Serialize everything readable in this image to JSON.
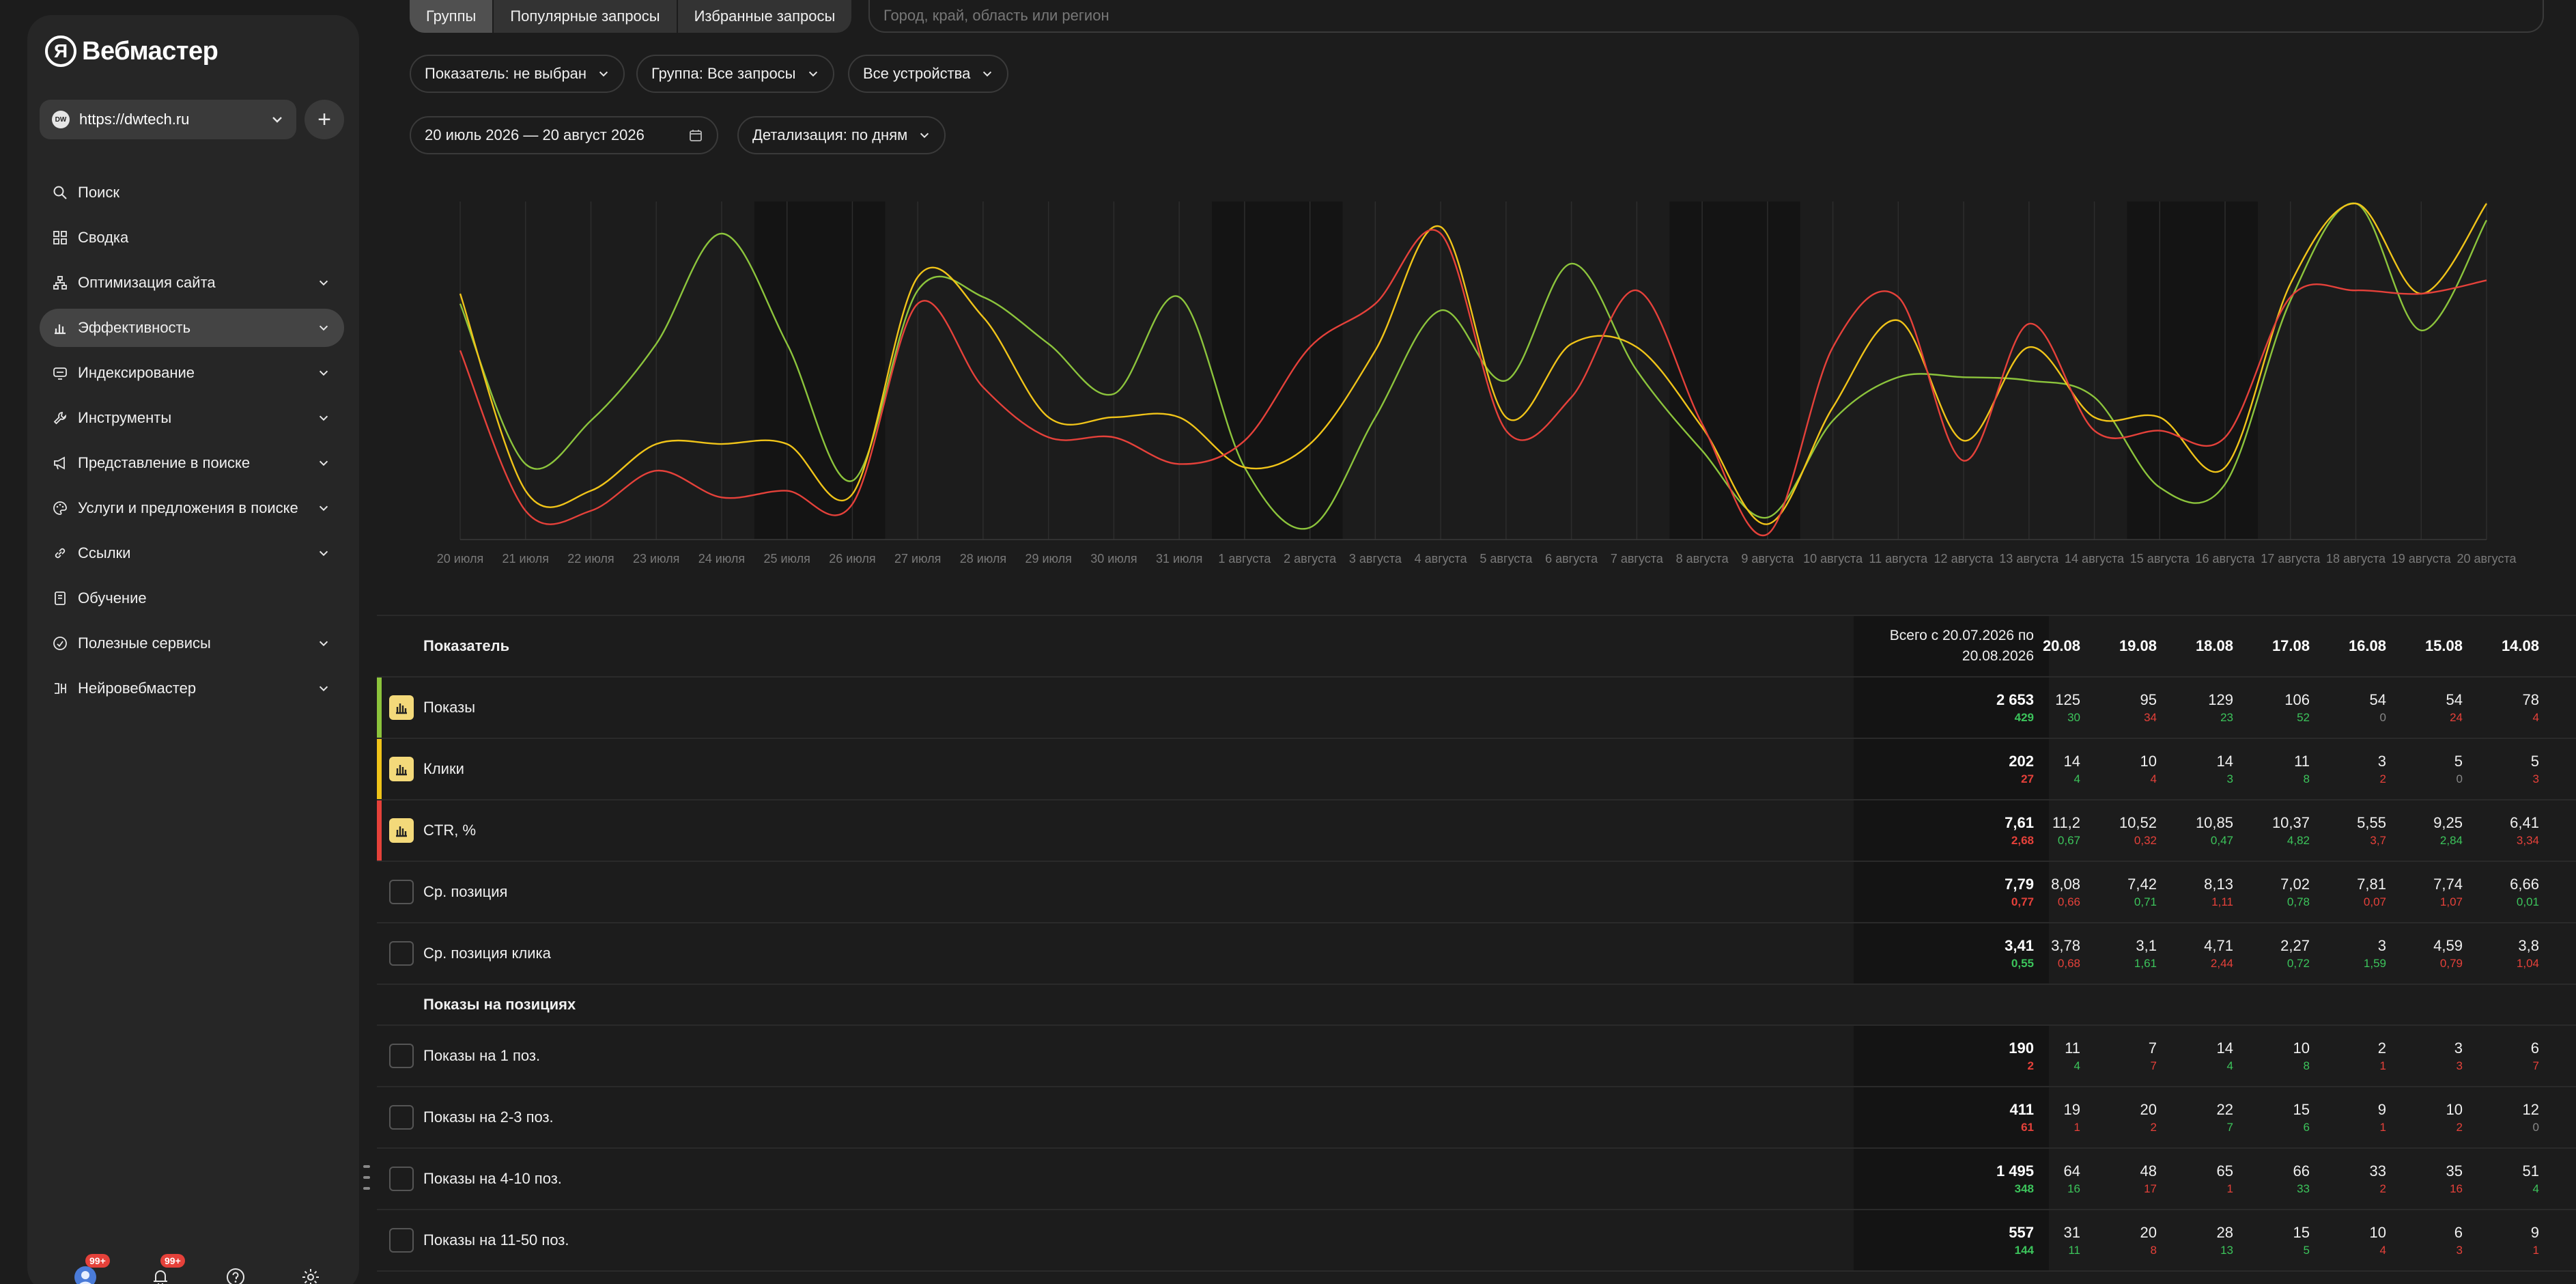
{
  "app": {
    "brand_letter": "Я",
    "brand": "Вебмастер"
  },
  "site": {
    "favicon": "DW",
    "url": "https://dwtech.ru",
    "add_label": "+"
  },
  "nav": [
    {
      "label": "Поиск",
      "icon": "search-icon",
      "expandable": false
    },
    {
      "label": "Сводка",
      "icon": "grid-icon",
      "expandable": false
    },
    {
      "label": "Оптимизация сайта",
      "icon": "hierarchy-icon",
      "expandable": true
    },
    {
      "label": "Эффективность",
      "icon": "bar-chart-icon",
      "expandable": true,
      "active": true
    },
    {
      "label": "Индексирование",
      "icon": "index-icon",
      "expandable": true
    },
    {
      "label": "Инструменты",
      "icon": "wrench-icon",
      "expandable": true
    },
    {
      "label": "Представление в поиске",
      "icon": "megaphone-icon",
      "expandable": true
    },
    {
      "label": "Услуги и предложения в поиске",
      "icon": "palette-icon",
      "expandable": true
    },
    {
      "label": "Ссылки",
      "icon": "link-icon",
      "expandable": true
    },
    {
      "label": "Обучение",
      "icon": "book-icon",
      "expandable": false
    },
    {
      "label": "Полезные сервисы",
      "icon": "services-icon",
      "expandable": true
    },
    {
      "label": "Нейровебмастер",
      "icon": "neuro-icon",
      "expandable": true
    }
  ],
  "bottom": {
    "avatar_badge": "99+",
    "bell_badge": "99+"
  },
  "tabs": [
    "Группы",
    "Популярные запросы",
    "Избранные запросы"
  ],
  "region_placeholder": "Город, край, область или регион",
  "filters": {
    "metric": "Показатель: не выбран",
    "group": "Группа: Все запросы",
    "devices": "Все устройства",
    "period": "20 июль 2026 — 20 август 2026",
    "detail": "Детализация: по дням"
  },
  "chart_data": {
    "type": "line",
    "categories": [
      "20 июля",
      "21 июля",
      "22 июля",
      "23 июля",
      "24 июля",
      "25 июля",
      "26 июля",
      "27 июля",
      "28 июля",
      "29 июля",
      "30 июля",
      "31 июля",
      "1 августа",
      "2 августа",
      "3 августа",
      "4 августа",
      "5 августа",
      "6 августа",
      "7 августа",
      "8 августа",
      "9 августа",
      "10 августа",
      "11 августа",
      "12 августа",
      "13 августа",
      "14 августа",
      "15 августа",
      "16 августа",
      "17 августа",
      "18 августа",
      "19 августа",
      "20 августа"
    ],
    "weekend_ranges": [
      [
        4.5,
        6.5
      ],
      [
        11.5,
        13.5
      ],
      [
        18.5,
        20.5
      ],
      [
        25.5,
        27.5
      ]
    ],
    "series": [
      {
        "color": "#8cc43c",
        "values": [
          70,
          22,
          35,
          58,
          91,
          58,
          17,
          74,
          72,
          58,
          43,
          72,
          21,
          3,
          36,
          68,
          47,
          82,
          50,
          26,
          6,
          35,
          48,
          48,
          47,
          42,
          15,
          16,
          71,
          100,
          62,
          95
        ]
      },
      {
        "color": "#f0c419",
        "values": [
          73,
          14,
          14,
          28,
          28,
          28,
          13,
          78,
          66,
          36,
          36,
          36,
          21,
          28,
          56,
          93,
          36,
          58,
          57,
          33,
          4,
          39,
          65,
          29,
          57,
          36,
          36,
          21,
          76,
          100,
          73,
          100
        ]
      },
      {
        "color": "#e5413a",
        "values": [
          56,
          8,
          8,
          20,
          12,
          14,
          10,
          70,
          45,
          30,
          30,
          22,
          29,
          57,
          70,
          91,
          32,
          42,
          74,
          34,
          1,
          57,
          72,
          23,
          64,
          32,
          32,
          30,
          72,
          74,
          73,
          77
        ]
      }
    ]
  },
  "table": {
    "header": {
      "label": "Показатель",
      "total_line1": "Всего с 20.07.2026 по",
      "total_line2": "20.08.2026",
      "dates": [
        "20.08",
        "19.08",
        "18.08",
        "17.08",
        "16.08",
        "15.08",
        "14.08"
      ]
    },
    "rows": [
      {
        "label": "Показы",
        "color": "#8cc43c",
        "selected": true,
        "total": "2 653",
        "total_delta": "429",
        "total_dir": "up",
        "values": [
          "125",
          "95",
          "129",
          "106",
          "54",
          "54",
          "78"
        ],
        "deltas": [
          "30",
          "34",
          "23",
          "52",
          "0",
          "24",
          "4"
        ],
        "dirs": [
          "up",
          "dn",
          "up",
          "up",
          "zero",
          "dn",
          "dn"
        ]
      },
      {
        "label": "Клики",
        "color": "#f0c419",
        "selected": true,
        "total": "202",
        "total_delta": "27",
        "total_dir": "dn",
        "values": [
          "14",
          "10",
          "14",
          "11",
          "3",
          "5",
          "5"
        ],
        "deltas": [
          "4",
          "4",
          "3",
          "8",
          "2",
          "0",
          "3"
        ],
        "dirs": [
          "up",
          "dn",
          "up",
          "up",
          "dn",
          "zero",
          "dn"
        ]
      },
      {
        "label": "CTR, %",
        "color": "#e5413a",
        "selected": true,
        "total": "7,61",
        "total_delta": "2,68",
        "total_dir": "dn",
        "values": [
          "11,2",
          "10,52",
          "10,85",
          "10,37",
          "5,55",
          "9,25",
          "6,41"
        ],
        "deltas": [
          "0,67",
          "0,32",
          "0,47",
          "4,82",
          "3,7",
          "2,84",
          "3,34"
        ],
        "dirs": [
          "up",
          "dn",
          "up",
          "up",
          "dn",
          "up",
          "dn"
        ]
      },
      {
        "label": "Ср. позиция",
        "selected": false,
        "total": "7,79",
        "total_delta": "0,77",
        "total_dir": "dn",
        "values": [
          "8,08",
          "7,42",
          "8,13",
          "7,02",
          "7,81",
          "7,74",
          "6,66"
        ],
        "deltas": [
          "0,66",
          "0,71",
          "1,11",
          "0,78",
          "0,07",
          "1,07",
          "0,01"
        ],
        "dirs": [
          "dn",
          "up",
          "dn",
          "up",
          "dn",
          "dn",
          "up"
        ]
      },
      {
        "label": "Ср. позиция клика",
        "selected": false,
        "total": "3,41",
        "total_delta": "0,55",
        "total_dir": "up",
        "values": [
          "3,78",
          "3,1",
          "4,71",
          "2,27",
          "3",
          "4,59",
          "3,8"
        ],
        "deltas": [
          "0,68",
          "1,61",
          "2,44",
          "0,72",
          "1,59",
          "0,79",
          "1,04"
        ],
        "dirs": [
          "dn",
          "up",
          "dn",
          "up",
          "up",
          "dn",
          "dn"
        ]
      }
    ],
    "section_label": "Показы на позициях",
    "position_rows": [
      {
        "label": "Показы на 1 поз.",
        "total": "190",
        "total_delta": "2",
        "total_dir": "dn",
        "values": [
          "11",
          "7",
          "14",
          "10",
          "2",
          "3",
          "6"
        ],
        "deltas": [
          "4",
          "7",
          "4",
          "8",
          "1",
          "3",
          "7"
        ],
        "dirs": [
          "up",
          "dn",
          "up",
          "up",
          "dn",
          "dn",
          "dn"
        ]
      },
      {
        "label": "Показы на 2-3 поз.",
        "total": "411",
        "total_delta": "61",
        "total_dir": "dn",
        "values": [
          "19",
          "20",
          "22",
          "15",
          "9",
          "10",
          "12"
        ],
        "deltas": [
          "1",
          "2",
          "7",
          "6",
          "1",
          "2",
          "0"
        ],
        "dirs": [
          "dn",
          "dn",
          "up",
          "up",
          "dn",
          "dn",
          "zero"
        ]
      },
      {
        "label": "Показы на 4-10 поз.",
        "total": "1 495",
        "total_delta": "348",
        "total_dir": "up",
        "values": [
          "64",
          "48",
          "65",
          "66",
          "33",
          "35",
          "51"
        ],
        "deltas": [
          "16",
          "17",
          "1",
          "33",
          "2",
          "16",
          "4"
        ],
        "dirs": [
          "up",
          "dn",
          "dn",
          "up",
          "dn",
          "dn",
          "up"
        ]
      },
      {
        "label": "Показы на 11-50 поз.",
        "total": "557",
        "total_delta": "144",
        "total_dir": "up",
        "values": [
          "31",
          "20",
          "28",
          "15",
          "10",
          "6",
          "9"
        ],
        "deltas": [
          "11",
          "8",
          "13",
          "5",
          "4",
          "3",
          "1"
        ],
        "dirs": [
          "up",
          "dn",
          "up",
          "up",
          "dn",
          "dn",
          "dn"
        ]
      }
    ]
  }
}
